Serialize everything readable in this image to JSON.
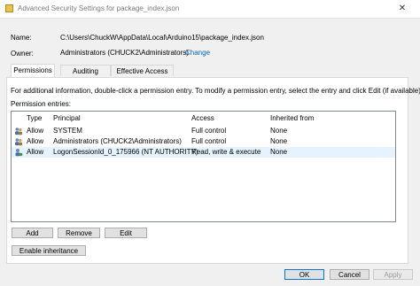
{
  "window": {
    "title": "Advanced Security Settings for package_index.json",
    "close_glyph": "✕"
  },
  "info": {
    "name_label": "Name:",
    "name_value": "C:\\Users\\ChuckW\\AppData\\Local\\Arduino15\\package_index.json",
    "owner_label": "Owner:",
    "owner_value": "Administrators (CHUCK2\\Administrators)",
    "change_link": "Change"
  },
  "tabs": [
    {
      "label": "Permissions",
      "active": true
    },
    {
      "label": "Auditing",
      "active": false
    },
    {
      "label": "Effective Access",
      "active": false
    }
  ],
  "permissions": {
    "description": "For additional information, double-click a permission entry. To modify a permission entry, select the entry and click Edit (if available).",
    "entries_label": "Permission entries:",
    "columns": [
      "Type",
      "Principal",
      "Access",
      "Inherited from"
    ],
    "rows": [
      {
        "type": "Allow",
        "principal": "SYSTEM",
        "access": "Full control",
        "inherited": "None",
        "icon": "user-group-icon"
      },
      {
        "type": "Allow",
        "principal": "Administrators (CHUCK2\\Administrators)",
        "access": "Full control",
        "inherited": "None",
        "icon": "user-group-icon"
      },
      {
        "type": "Allow",
        "principal": "LogonSessionId_0_175966 (NT AUTHORITY)",
        "access": "Read, write & execute",
        "inherited": "None",
        "icon": "user-session-icon"
      }
    ],
    "buttons": {
      "add": "Add",
      "remove": "Remove",
      "edit": "Edit",
      "enable_inheritance": "Enable inheritance"
    }
  },
  "dialog_buttons": {
    "ok": "OK",
    "cancel": "Cancel",
    "apply": "Apply"
  },
  "colors": {
    "link": "#0066cc",
    "selection": "#e5f3ff",
    "default_border": "#0078d7"
  }
}
